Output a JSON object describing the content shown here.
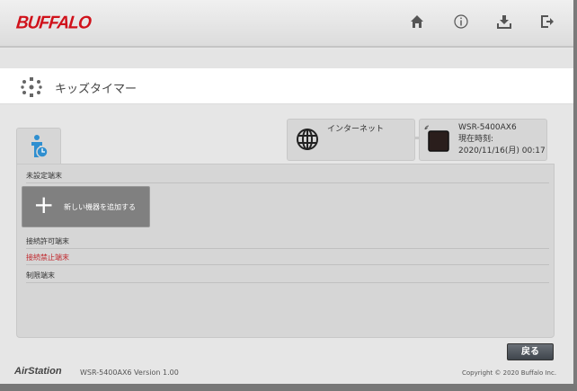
{
  "header": {
    "brand": "BUFFALO",
    "icons": [
      "home-icon",
      "info-icon",
      "download-icon",
      "logout-icon"
    ]
  },
  "page": {
    "title": "キッズタイマー"
  },
  "status": {
    "internet_label": "インターネット",
    "router_model": "WSR-5400AX6",
    "time_label": "現在時刻:",
    "time_value": "2020/11/16(月) 00:17"
  },
  "sections": {
    "unset": "未設定端末",
    "add_device": "新しい機器を追加する",
    "allowed": "接続許可端末",
    "blocked": "接続禁止端末",
    "restricted": "制限端末"
  },
  "buttons": {
    "back": "戻る"
  },
  "footer": {
    "product": "AirStation",
    "version": "WSR-5400AX6 Version 1.00",
    "copyright": "Copyright © 2020 Buffalo Inc."
  },
  "colors": {
    "brand": "#d0121b",
    "blocked": "#c0282d",
    "tab_icon": "#2f8fd0"
  }
}
